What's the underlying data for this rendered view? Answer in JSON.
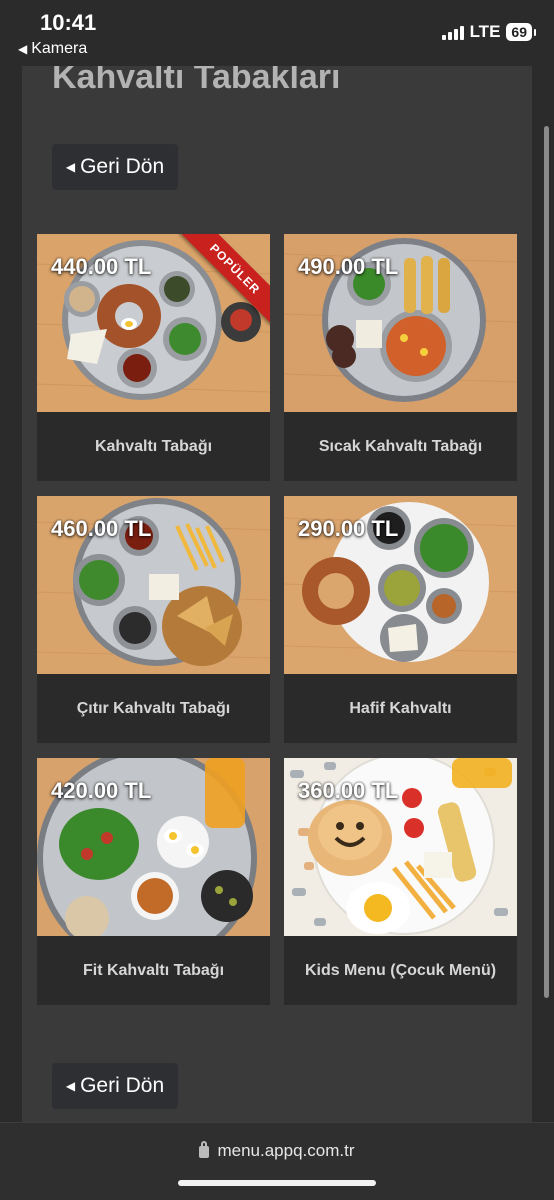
{
  "status_bar": {
    "time": "10:41",
    "back_app": "Kamera",
    "network": "LTE",
    "battery": "69"
  },
  "page": {
    "title": "Kahvaltı Tabakları",
    "back_label": "Geri Dön"
  },
  "products": [
    {
      "price": "440.00 TL",
      "name": "Kahvaltı Tabağı",
      "badge": "POPÜLER"
    },
    {
      "price": "490.00 TL",
      "name": "Sıcak Kahvaltı Tabağı"
    },
    {
      "price": "460.00 TL",
      "name": "Çıtır Kahvaltı Tabağı"
    },
    {
      "price": "290.00 TL",
      "name": "Hafif Kahvaltı"
    },
    {
      "price": "420.00 TL",
      "name": "Fit Kahvaltı Tabağı"
    },
    {
      "price": "360.00 TL",
      "name": "Kids Menu (Çocuk Menü)"
    }
  ],
  "browser": {
    "url": "menu.appq.com.tr"
  },
  "colors": {
    "panel": "#3a3a3a",
    "card_caption": "#2a2a2a",
    "ribbon": "#c9211e",
    "wood": "#d9a36a"
  }
}
